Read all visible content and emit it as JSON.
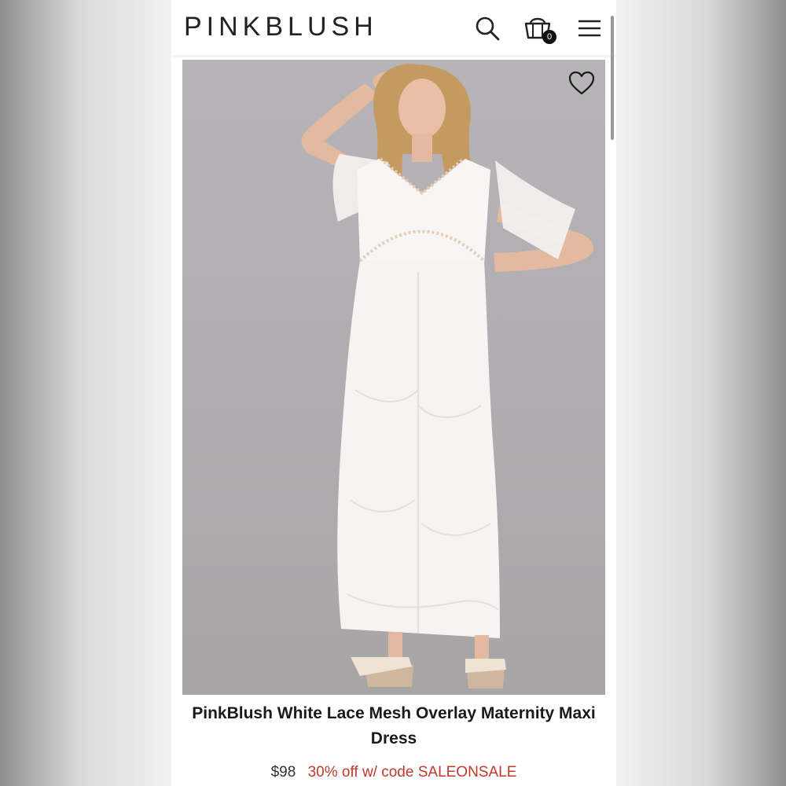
{
  "header": {
    "logo": "PINKBLUSH",
    "icons": [
      "search-icon",
      "shopping-bag-icon",
      "menu-icon"
    ],
    "cart_count": "0"
  },
  "product": {
    "title": "PinkBlush White Lace Mesh Overlay Maternity Maxi Dress",
    "price": "$98",
    "promo": "30% off w/ code SALEONSALE",
    "wishlist_icon": "heart-outline-icon"
  },
  "colors": {
    "promo": "#c0392b",
    "text": "#1a1a1a",
    "photo_background": "#b0aeb0"
  }
}
